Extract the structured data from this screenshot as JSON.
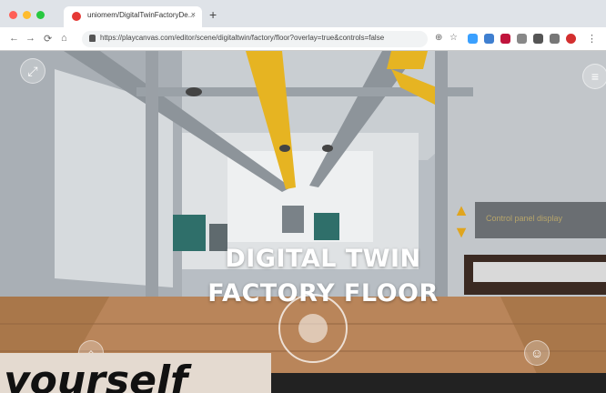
{
  "browser": {
    "tab_title": "uniomem/DigitalTwinFactoryDe...",
    "tab_close": "×",
    "new_tab": "+",
    "url": "https://playcanvas.com/editor/scene/digitaltwin/factory/floor?overlay=true&controls=false",
    "back": "←",
    "forward": "→",
    "reload": "⟳",
    "home": "⌂"
  },
  "scene": {
    "title_line1": "DIGITAL TWIN",
    "title_line2": "FACTORY FLOOR",
    "fullscreen_icon": "⤢",
    "menu_icon": "≡",
    "home_icon": "⌂",
    "people_icon": "☺",
    "info_panel_text": "Control panel display",
    "arrow_up": "▲",
    "arrow_down": "▼"
  },
  "caption": {
    "text": "yourself"
  },
  "colors": {
    "beam_yellow": "#e6b422",
    "floor_wood": "#a9774a",
    "panel_teal": "#2f6f6a"
  }
}
